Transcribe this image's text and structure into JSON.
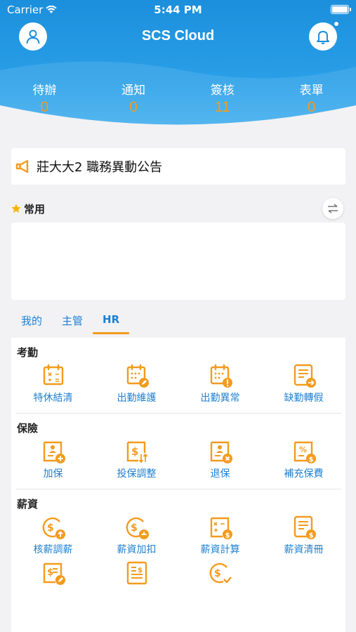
{
  "status_bar": {
    "carrier": "Carrier",
    "time": "5:44 PM"
  },
  "header": {
    "title": "SCS Cloud"
  },
  "stats": [
    {
      "label": "待辦",
      "value": "0"
    },
    {
      "label": "通知",
      "value": "0"
    },
    {
      "label": "簽核",
      "value": "11"
    },
    {
      "label": "表單",
      "value": "0"
    }
  ],
  "announcement": {
    "text": "莊大大2 職務異動公告"
  },
  "favorites": {
    "title": "常用"
  },
  "tabs": [
    {
      "label": "我的"
    },
    {
      "label": "主管"
    },
    {
      "label": "HR"
    }
  ],
  "sections": [
    {
      "title": "考勤",
      "items": [
        {
          "label": "特休結清",
          "icon": "calendar-calc-icon"
        },
        {
          "label": "出勤維護",
          "icon": "calendar-edit-icon"
        },
        {
          "label": "出勤異常",
          "icon": "calendar-alert-icon"
        },
        {
          "label": "缺勤轉假",
          "icon": "form-transfer-icon"
        }
      ]
    },
    {
      "title": "保險",
      "items": [
        {
          "label": "加保",
          "icon": "insurance-add-icon"
        },
        {
          "label": "投保調整",
          "icon": "insurance-adjust-icon"
        },
        {
          "label": "退保",
          "icon": "insurance-remove-icon"
        },
        {
          "label": "補充保費",
          "icon": "supplementary-premium-icon"
        }
      ]
    },
    {
      "title": "薪資",
      "items": [
        {
          "label": "核薪調薪",
          "icon": "salary-raise-icon"
        },
        {
          "label": "薪資加扣",
          "icon": "salary-adjust-icon"
        },
        {
          "label": "薪資計算",
          "icon": "salary-calc-icon"
        },
        {
          "label": "薪資清冊",
          "icon": "salary-list-icon"
        }
      ]
    }
  ],
  "colors": {
    "primary": "#1c8fdc",
    "accent": "#f39b1d",
    "link": "#1f7fd0"
  }
}
